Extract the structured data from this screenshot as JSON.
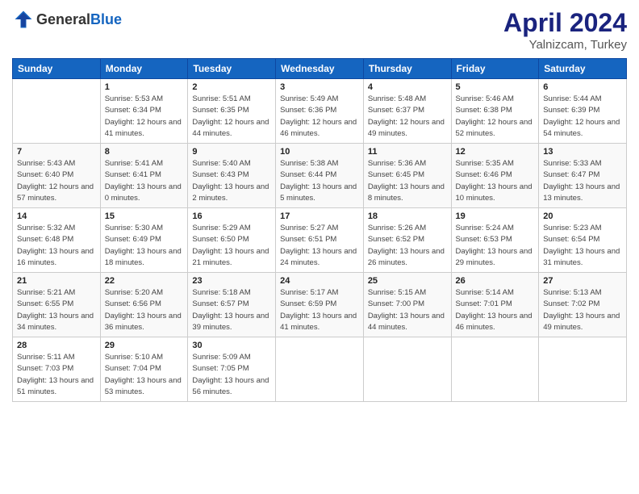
{
  "header": {
    "logo_general": "General",
    "logo_blue": "Blue",
    "month": "April 2024",
    "location": "Yalnizcam, Turkey"
  },
  "weekdays": [
    "Sunday",
    "Monday",
    "Tuesday",
    "Wednesday",
    "Thursday",
    "Friday",
    "Saturday"
  ],
  "weeks": [
    [
      {
        "day": "",
        "sunrise": "",
        "sunset": "",
        "daylight": ""
      },
      {
        "day": "1",
        "sunrise": "Sunrise: 5:53 AM",
        "sunset": "Sunset: 6:34 PM",
        "daylight": "Daylight: 12 hours and 41 minutes."
      },
      {
        "day": "2",
        "sunrise": "Sunrise: 5:51 AM",
        "sunset": "Sunset: 6:35 PM",
        "daylight": "Daylight: 12 hours and 44 minutes."
      },
      {
        "day": "3",
        "sunrise": "Sunrise: 5:49 AM",
        "sunset": "Sunset: 6:36 PM",
        "daylight": "Daylight: 12 hours and 46 minutes."
      },
      {
        "day": "4",
        "sunrise": "Sunrise: 5:48 AM",
        "sunset": "Sunset: 6:37 PM",
        "daylight": "Daylight: 12 hours and 49 minutes."
      },
      {
        "day": "5",
        "sunrise": "Sunrise: 5:46 AM",
        "sunset": "Sunset: 6:38 PM",
        "daylight": "Daylight: 12 hours and 52 minutes."
      },
      {
        "day": "6",
        "sunrise": "Sunrise: 5:44 AM",
        "sunset": "Sunset: 6:39 PM",
        "daylight": "Daylight: 12 hours and 54 minutes."
      }
    ],
    [
      {
        "day": "7",
        "sunrise": "Sunrise: 5:43 AM",
        "sunset": "Sunset: 6:40 PM",
        "daylight": "Daylight: 12 hours and 57 minutes."
      },
      {
        "day": "8",
        "sunrise": "Sunrise: 5:41 AM",
        "sunset": "Sunset: 6:41 PM",
        "daylight": "Daylight: 13 hours and 0 minutes."
      },
      {
        "day": "9",
        "sunrise": "Sunrise: 5:40 AM",
        "sunset": "Sunset: 6:43 PM",
        "daylight": "Daylight: 13 hours and 2 minutes."
      },
      {
        "day": "10",
        "sunrise": "Sunrise: 5:38 AM",
        "sunset": "Sunset: 6:44 PM",
        "daylight": "Daylight: 13 hours and 5 minutes."
      },
      {
        "day": "11",
        "sunrise": "Sunrise: 5:36 AM",
        "sunset": "Sunset: 6:45 PM",
        "daylight": "Daylight: 13 hours and 8 minutes."
      },
      {
        "day": "12",
        "sunrise": "Sunrise: 5:35 AM",
        "sunset": "Sunset: 6:46 PM",
        "daylight": "Daylight: 13 hours and 10 minutes."
      },
      {
        "day": "13",
        "sunrise": "Sunrise: 5:33 AM",
        "sunset": "Sunset: 6:47 PM",
        "daylight": "Daylight: 13 hours and 13 minutes."
      }
    ],
    [
      {
        "day": "14",
        "sunrise": "Sunrise: 5:32 AM",
        "sunset": "Sunset: 6:48 PM",
        "daylight": "Daylight: 13 hours and 16 minutes."
      },
      {
        "day": "15",
        "sunrise": "Sunrise: 5:30 AM",
        "sunset": "Sunset: 6:49 PM",
        "daylight": "Daylight: 13 hours and 18 minutes."
      },
      {
        "day": "16",
        "sunrise": "Sunrise: 5:29 AM",
        "sunset": "Sunset: 6:50 PM",
        "daylight": "Daylight: 13 hours and 21 minutes."
      },
      {
        "day": "17",
        "sunrise": "Sunrise: 5:27 AM",
        "sunset": "Sunset: 6:51 PM",
        "daylight": "Daylight: 13 hours and 24 minutes."
      },
      {
        "day": "18",
        "sunrise": "Sunrise: 5:26 AM",
        "sunset": "Sunset: 6:52 PM",
        "daylight": "Daylight: 13 hours and 26 minutes."
      },
      {
        "day": "19",
        "sunrise": "Sunrise: 5:24 AM",
        "sunset": "Sunset: 6:53 PM",
        "daylight": "Daylight: 13 hours and 29 minutes."
      },
      {
        "day": "20",
        "sunrise": "Sunrise: 5:23 AM",
        "sunset": "Sunset: 6:54 PM",
        "daylight": "Daylight: 13 hours and 31 minutes."
      }
    ],
    [
      {
        "day": "21",
        "sunrise": "Sunrise: 5:21 AM",
        "sunset": "Sunset: 6:55 PM",
        "daylight": "Daylight: 13 hours and 34 minutes."
      },
      {
        "day": "22",
        "sunrise": "Sunrise: 5:20 AM",
        "sunset": "Sunset: 6:56 PM",
        "daylight": "Daylight: 13 hours and 36 minutes."
      },
      {
        "day": "23",
        "sunrise": "Sunrise: 5:18 AM",
        "sunset": "Sunset: 6:57 PM",
        "daylight": "Daylight: 13 hours and 39 minutes."
      },
      {
        "day": "24",
        "sunrise": "Sunrise: 5:17 AM",
        "sunset": "Sunset: 6:59 PM",
        "daylight": "Daylight: 13 hours and 41 minutes."
      },
      {
        "day": "25",
        "sunrise": "Sunrise: 5:15 AM",
        "sunset": "Sunset: 7:00 PM",
        "daylight": "Daylight: 13 hours and 44 minutes."
      },
      {
        "day": "26",
        "sunrise": "Sunrise: 5:14 AM",
        "sunset": "Sunset: 7:01 PM",
        "daylight": "Daylight: 13 hours and 46 minutes."
      },
      {
        "day": "27",
        "sunrise": "Sunrise: 5:13 AM",
        "sunset": "Sunset: 7:02 PM",
        "daylight": "Daylight: 13 hours and 49 minutes."
      }
    ],
    [
      {
        "day": "28",
        "sunrise": "Sunrise: 5:11 AM",
        "sunset": "Sunset: 7:03 PM",
        "daylight": "Daylight: 13 hours and 51 minutes."
      },
      {
        "day": "29",
        "sunrise": "Sunrise: 5:10 AM",
        "sunset": "Sunset: 7:04 PM",
        "daylight": "Daylight: 13 hours and 53 minutes."
      },
      {
        "day": "30",
        "sunrise": "Sunrise: 5:09 AM",
        "sunset": "Sunset: 7:05 PM",
        "daylight": "Daylight: 13 hours and 56 minutes."
      },
      {
        "day": "",
        "sunrise": "",
        "sunset": "",
        "daylight": ""
      },
      {
        "day": "",
        "sunrise": "",
        "sunset": "",
        "daylight": ""
      },
      {
        "day": "",
        "sunrise": "",
        "sunset": "",
        "daylight": ""
      },
      {
        "day": "",
        "sunrise": "",
        "sunset": "",
        "daylight": ""
      }
    ]
  ]
}
